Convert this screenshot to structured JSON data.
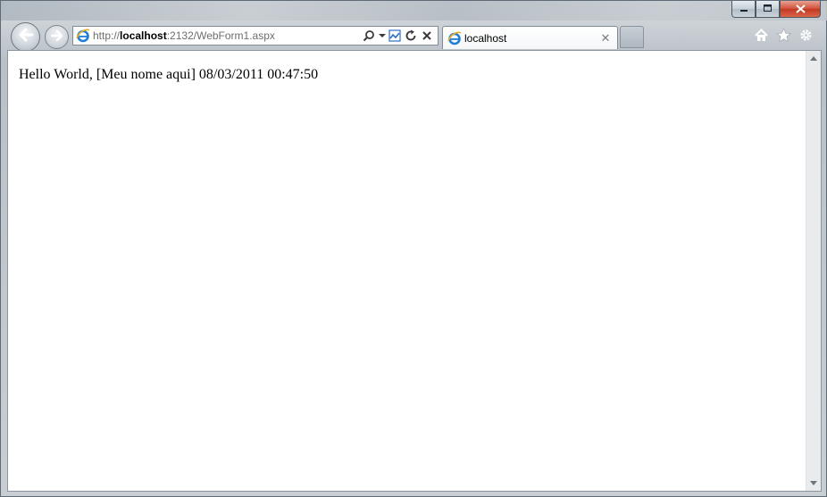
{
  "window": {
    "caption_buttons": {
      "minimize": "minimize-icon",
      "maximize": "maximize-icon",
      "close": "close-icon"
    }
  },
  "nav": {
    "back_icon": "back-arrow-icon",
    "forward_icon": "forward-arrow-icon"
  },
  "address_bar": {
    "url_prefix": "http://",
    "url_host": "localhost",
    "url_rest": ":2132/WebForm1.aspx",
    "icons": [
      "search-icon",
      "dropdown-icon",
      "compatibility-icon",
      "refresh-icon",
      "stop-icon"
    ]
  },
  "tabs": [
    {
      "label": "localhost",
      "close_glyph": "✕"
    }
  ],
  "toolbar_icons": [
    "home-icon",
    "favorites-icon",
    "tools-icon"
  ],
  "page": {
    "text": "Hello World, [Meu nome aqui] 08/03/2011 00:47:50"
  },
  "colors": {
    "ie_blue": "#1e7fd9",
    "ie_gold": "#e8b020",
    "close_red": "#c9422a"
  }
}
